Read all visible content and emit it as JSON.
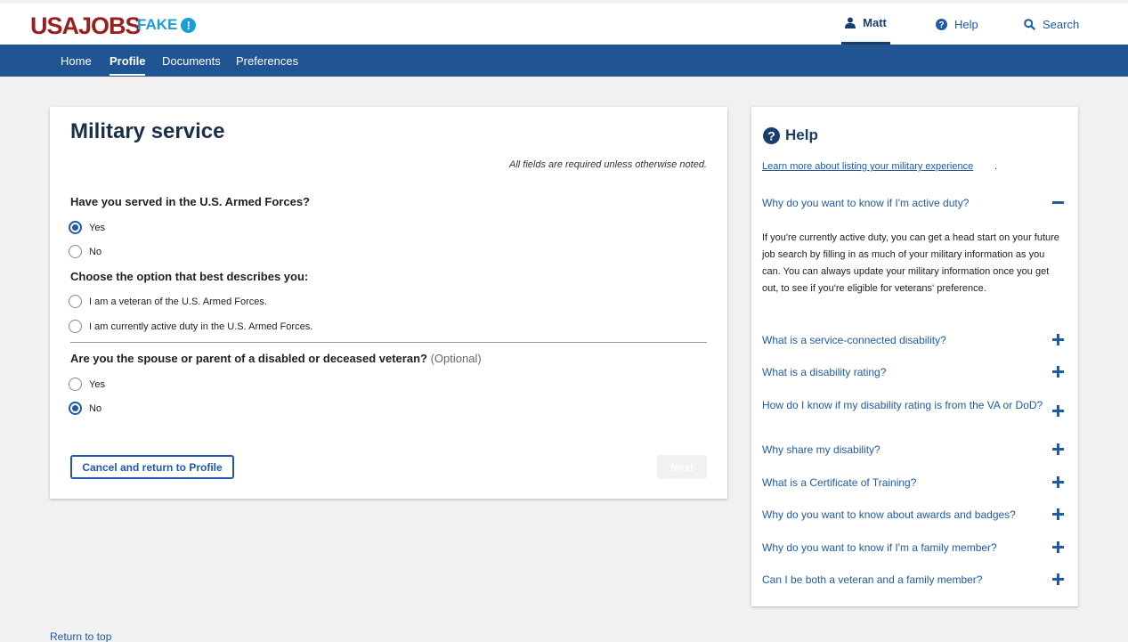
{
  "header": {
    "logo": "USAJOBS",
    "fake_label": "FAKE",
    "fake_badge": "!",
    "user_name": "Matt",
    "help_label": "Help",
    "search_label": "Search"
  },
  "nav": {
    "items": [
      {
        "label": "Home"
      },
      {
        "label": "Profile",
        "active": true
      },
      {
        "label": "Documents"
      },
      {
        "label": "Preferences"
      }
    ]
  },
  "form": {
    "title": "Military service",
    "required_note": "All fields are required unless otherwise noted.",
    "q1": {
      "label": "Have you served in the U.S. Armed Forces?",
      "options": [
        {
          "label": "Yes",
          "checked": true
        },
        {
          "label": "No",
          "checked": false
        }
      ]
    },
    "q2": {
      "label": "Choose the option that best describes you:",
      "options": [
        {
          "label": "I am a veteran of the U.S. Armed Forces.",
          "checked": false
        },
        {
          "label": "I am currently active duty in the U.S. Armed Forces.",
          "checked": false
        }
      ]
    },
    "q3": {
      "label": "Are you the spouse or parent of a disabled or deceased veteran?",
      "optional": "(Optional)",
      "options": [
        {
          "label": "Yes",
          "checked": false
        },
        {
          "label": "No",
          "checked": true
        }
      ]
    },
    "cancel_label": "Cancel and return to Profile",
    "next_label": "Next"
  },
  "help": {
    "title": "Help",
    "link": "Learn more about listing your military experience",
    "link_suffix": ".",
    "faqs": [
      {
        "q": "Why do you want to know if I'm active duty?",
        "expanded": true,
        "a": "If you're currently active duty, you can get a head start on your future job search by filling in as much of your military information as you can. You can always update your military information once you get out, to see if you're eligible for veterans' preference."
      },
      {
        "q": "What is a service-connected disability?",
        "expanded": false
      },
      {
        "q": "What is a disability rating?",
        "expanded": false
      },
      {
        "q": "How do I know if my disability rating is from the VA or DoD?",
        "expanded": false
      },
      {
        "q": "Why share my disability?",
        "expanded": false
      },
      {
        "q": "What is a Certificate of Training?",
        "expanded": false
      },
      {
        "q": "Why do you want to know about awards and badges?",
        "expanded": false
      },
      {
        "q": "Why do you want to know if I'm a family member?",
        "expanded": false
      },
      {
        "q": "Can I be both a veteran and a family member?",
        "expanded": false
      }
    ]
  },
  "footer": {
    "return_top": "Return to top"
  },
  "colors": {
    "nav_blue": "#205493",
    "link_blue": "#1e5aa8",
    "logo_red": "#9c1f1f",
    "fake_blue": "#1a9ed8"
  }
}
